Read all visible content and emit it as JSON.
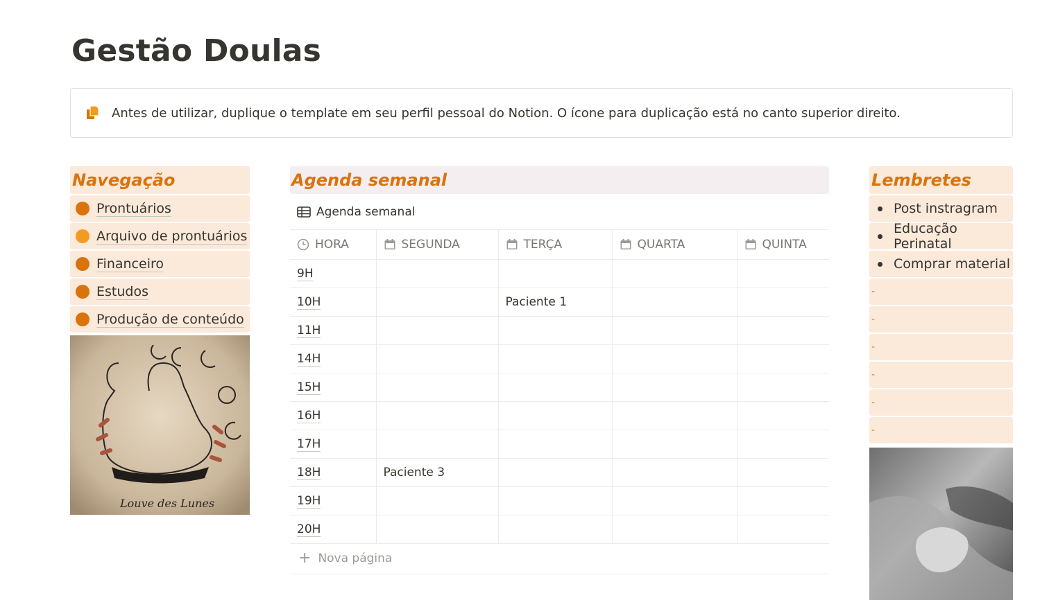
{
  "page": {
    "title": "Gestão Doulas"
  },
  "callout": {
    "icon": "duplicate-pages-icon",
    "text": "Antes de utilizar, duplique o template em seu perfil pessoal do Notion. O ícone para duplicação está no canto superior direito."
  },
  "navigation": {
    "heading": "Navegação",
    "items": [
      {
        "label": "Prontuários",
        "dot_color": "#d9730d"
      },
      {
        "label": "Arquivo de prontuários",
        "dot_color": "#f29b21"
      },
      {
        "label": "Financeiro",
        "dot_color": "#d9730d"
      },
      {
        "label": "Estudos",
        "dot_color": "#d9730d"
      },
      {
        "label": "Produção de conteúdo",
        "dot_color": "#d9730d"
      }
    ],
    "image_caption": "Louve des Lunes"
  },
  "agenda": {
    "heading": "Agenda semanal",
    "view_name": "Agenda semanal",
    "columns": [
      "HORA",
      "SEGUNDA",
      "TERÇA",
      "QUARTA",
      "QUINTA"
    ],
    "rows": [
      {
        "hora": "9H",
        "segunda": "",
        "terca": "",
        "quarta": "",
        "quinta": ""
      },
      {
        "hora": "10H",
        "segunda": "",
        "terca": "Paciente 1",
        "quarta": "",
        "quinta": ""
      },
      {
        "hora": "11H",
        "segunda": "",
        "terca": "",
        "quarta": "",
        "quinta": ""
      },
      {
        "hora": "14H",
        "segunda": "",
        "terca": "",
        "quarta": "",
        "quinta": ""
      },
      {
        "hora": "15H",
        "segunda": "",
        "terca": "",
        "quarta": "",
        "quinta": ""
      },
      {
        "hora": "16H",
        "segunda": "",
        "terca": "",
        "quarta": "",
        "quinta": ""
      },
      {
        "hora": "17H",
        "segunda": "",
        "terca": "",
        "quarta": "",
        "quinta": ""
      },
      {
        "hora": "18H",
        "segunda": "Paciente 3",
        "terca": "",
        "quarta": "",
        "quinta": ""
      },
      {
        "hora": "19H",
        "segunda": "",
        "terca": "",
        "quarta": "",
        "quinta": ""
      },
      {
        "hora": "20H",
        "segunda": "",
        "terca": "",
        "quarta": "",
        "quinta": ""
      }
    ],
    "add_label": "Nova página"
  },
  "reminders": {
    "heading": "Lembretes",
    "items": [
      "Post instragram",
      "Educação Perinatal",
      "Comprar material"
    ],
    "empty_items": [
      "-",
      "-",
      "-",
      "-",
      "-",
      "-"
    ]
  },
  "colors": {
    "accent": "#d9730d",
    "accent_light": "#f29b21",
    "block_bg": "#fbe9da",
    "agenda_heading_bg": "#f5eef0"
  }
}
